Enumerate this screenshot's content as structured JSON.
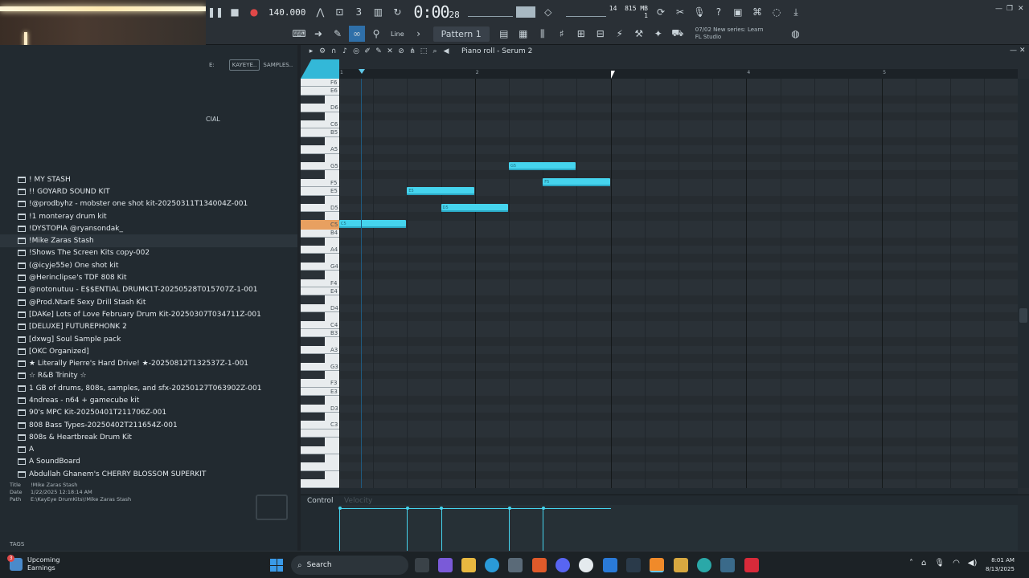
{
  "toolbar": {
    "tempo": "140.000",
    "time_main": "0:00",
    "time_sub": "28",
    "time_unit": "M:S:CS",
    "cpu_top": "14",
    "ram": "815 MB",
    "cpu_bottom": "1",
    "snap": "Line",
    "pattern": "Pattern 1",
    "news_line1": "07/02  New series: Learn",
    "news_line2": "FL Studio"
  },
  "browser": {
    "header_e": "E:",
    "tab_kayeye": "KAYEYE..",
    "tab_samples": "SAMPLES..",
    "cut_text": "CIAL",
    "folders": [
      "! MY STASH",
      "!! GOYARD SOUND KIT",
      "!@prodbyhz - mobster one shot kit-20250311T134004Z-001",
      "!1 monteray drum kit",
      "!DYSTOPIA @ryansondak_",
      "!Mike Zaras Stash",
      "!Shows The Screen Kits copy-002",
      "(@icyje55e) One shot kit",
      "@Herinclipse's TDF 808 Kit",
      "@notonutuu - E$$ENTIAL DRUMK1T-20250528T015707Z-1-001",
      "@Prod.NtarE Sexy Drill Stash Kit",
      "[DAKe] Lots of Love February Drum Kit-20250307T034711Z-001",
      "[DELUXE] FUTUREPHONK 2",
      "[dxwg] Soul Sample pack",
      "[OKC Organized]",
      "★ Literally Pierre's Hard Drive! ★-20250812T132537Z-1-001",
      "☆ R&B Trinity ☆",
      "1 GB of drums, 808s, samples, and sfx-20250127T063902Z-001",
      "4ndreas - n64 + gamecube kit",
      "90's MPC Kit-20250401T211706Z-001",
      "808 Bass Types-20250402T211654Z-001",
      "808s & Heartbreak Drum Kit",
      "A",
      "A SoundBoard",
      "Abdullah Ghanem's CHERRY BLOSSOM SUPERKIT"
    ],
    "selected_index": 5,
    "info": {
      "title_key": "Title",
      "title_val": "!Mike Zaras Stash",
      "date_key": "Date",
      "date_val": "1/22/2025 12:18:14 AM",
      "path_key": "Path",
      "path_val": "E:\\KayEye DrumKits\\!Mike Zaras Stash"
    },
    "tags_label": "TAGS"
  },
  "piano_roll": {
    "title": "Piano roll - Serum 2",
    "bar_numbers": [
      "1",
      "2",
      "4",
      "5"
    ],
    "key_labels": [
      "F6",
      "E6",
      "D6",
      "C6",
      "B5",
      "A5",
      "G5",
      "F5",
      "E5",
      "D5",
      "C5",
      "B4",
      "A4",
      "G4",
      "F4",
      "E4",
      "D4",
      "C4",
      "B3",
      "A3",
      "G3",
      "F3",
      "E3",
      "D3",
      "C3"
    ],
    "highlighted_key": "C5",
    "control_label": "Control",
    "control_param": "Velocity"
  },
  "chart_data": {
    "type": "scatter",
    "notes": [
      {
        "pitch": "C5",
        "start_beat": 0.0,
        "length_beats": 2.0,
        "velocity": 1.0
      },
      {
        "pitch": "E5",
        "start_beat": 2.0,
        "length_beats": 2.0,
        "velocity": 1.0
      },
      {
        "pitch": "D5",
        "start_beat": 3.0,
        "length_beats": 2.0,
        "velocity": 1.0
      },
      {
        "pitch": "G5",
        "start_beat": 5.0,
        "length_beats": 2.0,
        "velocity": 1.0
      },
      {
        "pitch": "F5",
        "start_beat": 6.0,
        "length_beats": 2.0,
        "velocity": 1.0
      }
    ]
  },
  "taskbar": {
    "weather_title": "Upcoming",
    "weather_sub": "Earnings",
    "weather_badge": "3",
    "search": "Search",
    "time": "8:01 AM",
    "date": "8/13/2025"
  },
  "colors": {
    "accent": "#45d4ee",
    "record": "#e04848",
    "highlight_key": "#e8a060"
  }
}
